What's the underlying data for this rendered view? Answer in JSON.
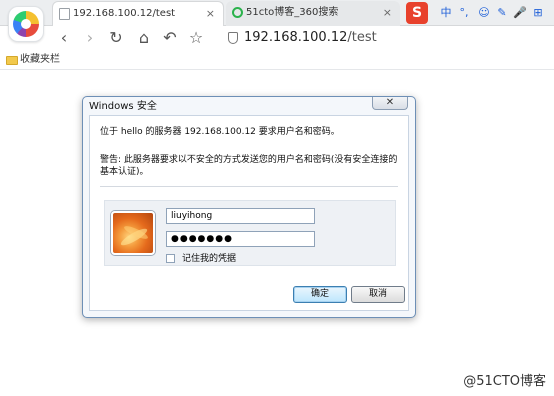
{
  "browser": {
    "tabs": [
      {
        "title": "192.168.100.12/test",
        "close": "×",
        "favicon": "document-icon"
      },
      {
        "title": "51cto博客_360搜索",
        "close": "×",
        "favicon": "search-icon"
      }
    ],
    "extensions": {
      "sogou_label": "S",
      "ime_items": [
        "中",
        "°,",
        "☺",
        "✎",
        "🎤",
        "⊞"
      ]
    },
    "nav": {
      "back": "‹",
      "forward": "›",
      "reload": "↻",
      "home": "⌂",
      "undo": "↶",
      "star": "☆"
    },
    "address": {
      "host": "192.168.100.12",
      "path": "/test"
    },
    "bookmarks_bar": {
      "folder_label": "收藏夹栏"
    }
  },
  "dialog": {
    "title": "Windows 安全",
    "close": "✕",
    "message": "位于 hello 的服务器 192.168.100.12 要求用户名和密码。",
    "warning": "警告: 此服务器要求以不安全的方式发送您的用户名和密码(没有安全连接的基本认证)。",
    "username_value": "liuyihong",
    "password_mask": "●●●●●●●",
    "remember_label": "记住我的凭据",
    "remember_checked": false,
    "ok_label": "确定",
    "cancel_label": "取消"
  },
  "watermark": "@51CTO博客",
  "colors": {
    "accent": "#3c7fb1",
    "dialog_border": "#6d8fb6",
    "sogou": "#e8412c"
  }
}
